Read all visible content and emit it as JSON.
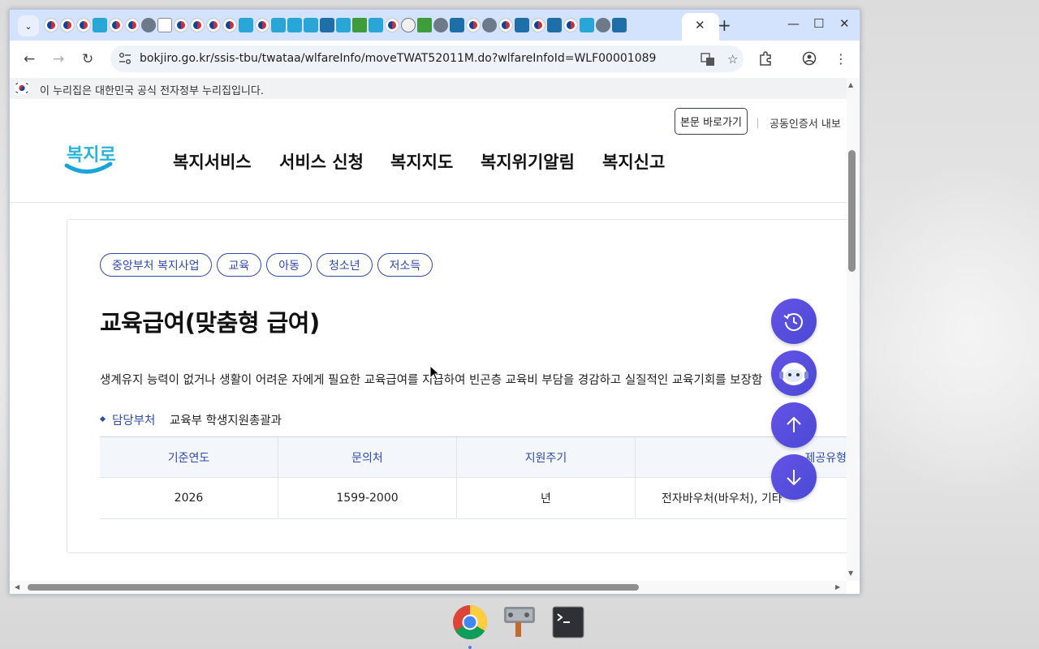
{
  "browser": {
    "url": "bokjiro.go.kr/ssis-tbu/twataa/wlfareInfo/moveTWAT52011M.do?wlfareInfoId=WLF00001089",
    "tab_favicons": [
      "k",
      "k",
      "k",
      "b",
      "k",
      "k",
      "g",
      "t",
      "k",
      "k",
      "k",
      "k",
      "b",
      "k",
      "b",
      "b",
      "b",
      "h",
      "b",
      "p",
      "b",
      "k",
      "o",
      "p",
      "g",
      "h",
      "k",
      "g",
      "k",
      "h",
      "k",
      "h",
      "k",
      "b",
      "g",
      "h"
    ],
    "new_tab_label": "+",
    "tab_close_label": "✕"
  },
  "site": {
    "gov_notice": "이 누리집은 대한민국 공식 전자정부 누리집입니다.",
    "skip_button": "본문 바로가기",
    "cert_link": "공동인증서 내보",
    "logo_text": "복지로",
    "nav": [
      "복지서비스",
      "서비스 신청",
      "복지지도",
      "복지위기알림",
      "복지신고"
    ]
  },
  "detail": {
    "chips": [
      "중앙부처 복지사업",
      "교육",
      "아동",
      "청소년",
      "저소득"
    ],
    "title": "교육급여(맞춤형 급여)",
    "description": "생계유지 능력이 없거나 생활이 어려운 자에게 필요한 교육급여를 지급하여 빈곤층 교육비 부담을 경감하고 실질적인 교육기회를 보장함",
    "dept_label": "담당부처",
    "dept_value": "교육부 학생지원총괄과",
    "table": {
      "headers": [
        "기준연도",
        "문의처",
        "지원주기",
        "제공유형"
      ],
      "row": [
        "2026",
        "1599-2000",
        "년",
        "전자바우처(바우처), 기타"
      ]
    }
  },
  "fab": [
    "recent-history",
    "chatbot",
    "scroll-top",
    "scroll-bottom"
  ],
  "taskbar": [
    "chrome",
    "settings-tool",
    "terminal"
  ]
}
